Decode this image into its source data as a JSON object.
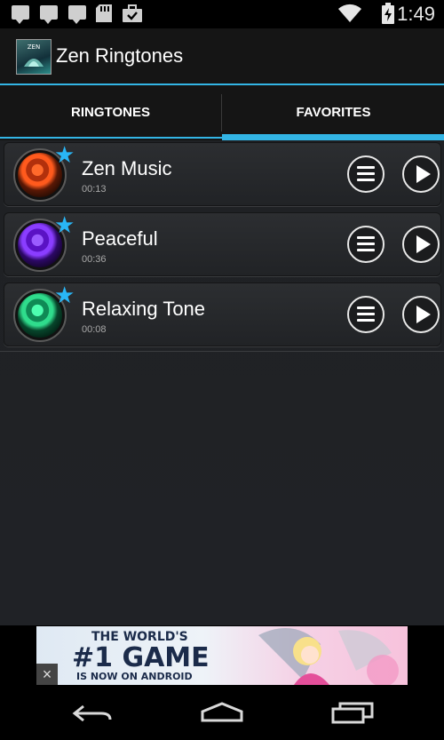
{
  "status_bar": {
    "notification_icons": [
      "chat-bubble-icon",
      "chat-bubble-icon",
      "chat-bubble-icon",
      "sd-card-icon",
      "briefcase-check-icon"
    ],
    "time": "1:49",
    "system_icons": [
      "wifi-icon",
      "battery-charging-icon"
    ]
  },
  "app_bar": {
    "icon_text": "ZEN",
    "title": "Zen Ringtones"
  },
  "tabs": [
    {
      "label": "RINGTONES",
      "selected": false
    },
    {
      "label": "FAVORITES",
      "selected": true
    }
  ],
  "ringtones": [
    {
      "title": "Zen Music",
      "duration": "00:13",
      "color": "#e8491d",
      "favorite": true
    },
    {
      "title": "Peaceful",
      "duration": "00:36",
      "color": "#7b2ff2",
      "favorite": true
    },
    {
      "title": "Relaxing Tone",
      "duration": "00:08",
      "color": "#1fb47a",
      "favorite": true
    }
  ],
  "ad": {
    "line1": "THE WORLD'S",
    "line2": "#1 GAME",
    "line3": "IS NOW ON ANDROID",
    "close": "×"
  },
  "colors": {
    "accent": "#33b5e5",
    "star": "#29b6f6"
  },
  "nav_bar": {
    "icons": [
      "back-icon",
      "home-icon",
      "recent-apps-icon"
    ]
  }
}
